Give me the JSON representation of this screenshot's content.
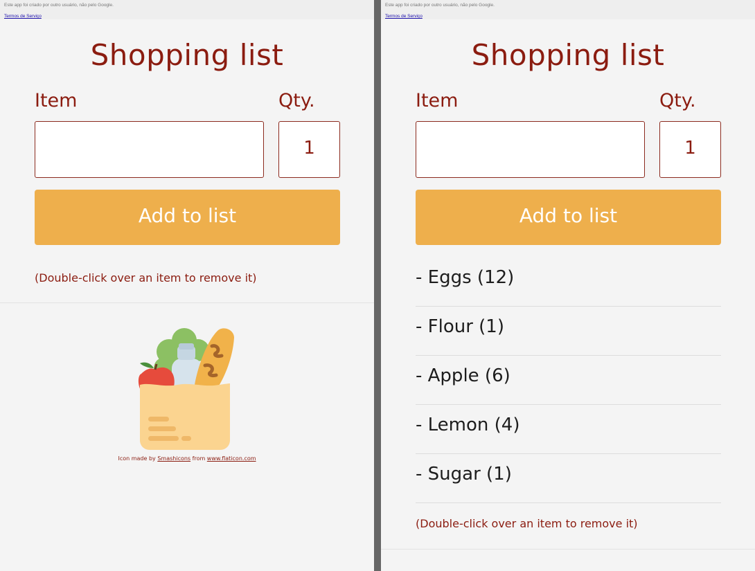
{
  "google_bar": {
    "notice": "Este app foi criado por outro usuário, não pelo Google.",
    "terms": "Termos de Serviço"
  },
  "app": {
    "title": "Shopping list",
    "item_label": "Item",
    "qty_label": "Qty.",
    "item_value": "",
    "qty_value": "1",
    "add_button": "Add to list",
    "hint": "(Double-click over an item to remove it)"
  },
  "empty_state": {
    "icon": "grocery-bag-icon",
    "credit_prefix": "Icon made by ",
    "credit_author": "Smashicons",
    "credit_mid": " from ",
    "credit_site": "www.flaticon.com"
  },
  "items": [
    "- Eggs (12)",
    "- Flour (1)",
    "- Apple (6)",
    "- Lemon (4)",
    "- Sugar (1)"
  ],
  "colors": {
    "accent": "#8b1c10",
    "button": "#eeaf4c",
    "background": "#f4f4f4",
    "frame": "#666666"
  }
}
